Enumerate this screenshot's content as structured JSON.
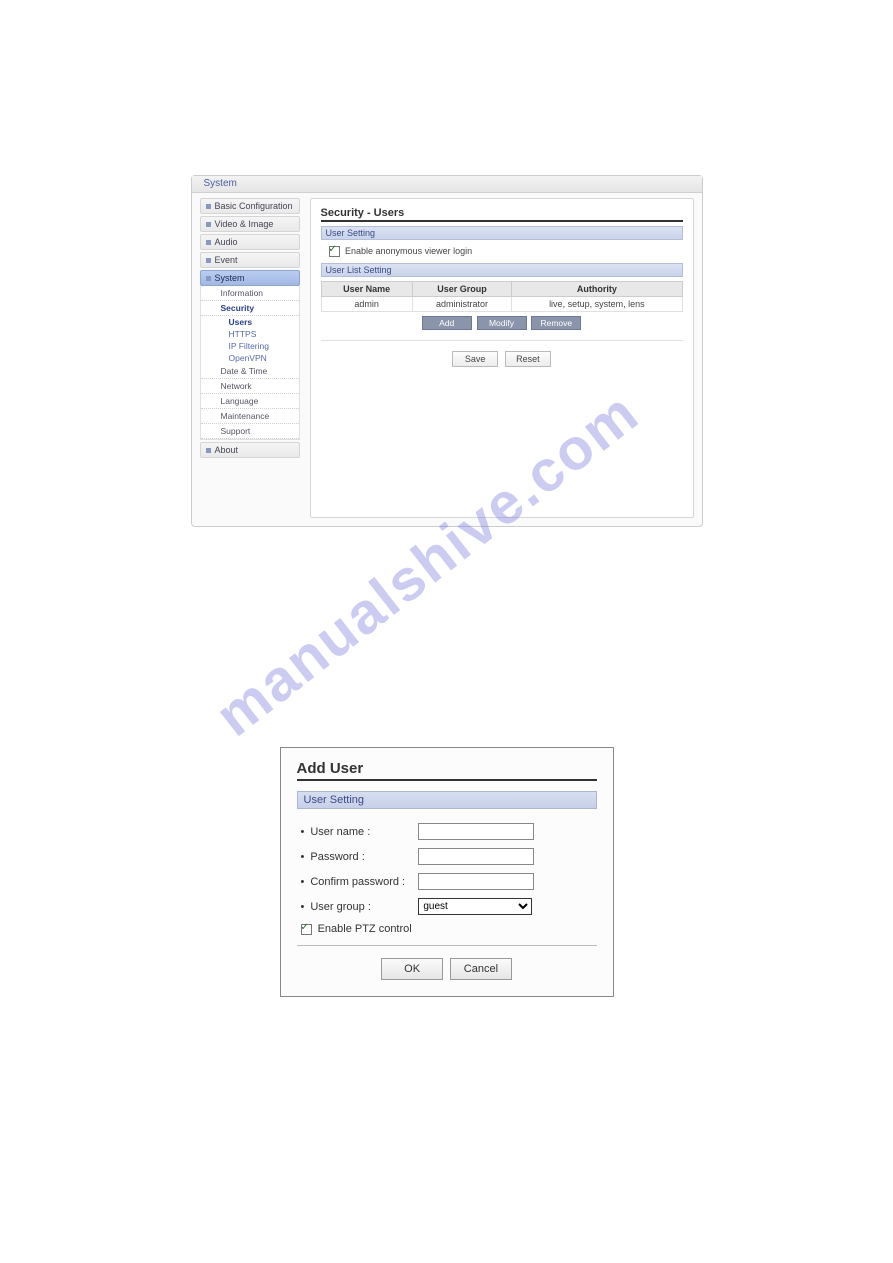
{
  "watermark": "manualshive.com",
  "top_panel": {
    "window_title": "System",
    "sidebar": {
      "items": [
        {
          "label": "Basic Configuration",
          "active": false,
          "subs": []
        },
        {
          "label": "Video & Image",
          "active": false,
          "subs": []
        },
        {
          "label": "Audio",
          "active": false,
          "subs": []
        },
        {
          "label": "Event",
          "active": false,
          "subs": []
        },
        {
          "label": "System",
          "active": true,
          "subs": [
            {
              "label": "Information",
              "level": 1,
              "active": false
            },
            {
              "label": "Security",
              "level": 1,
              "active": true
            },
            {
              "label": "Users",
              "level": 2,
              "active": true
            },
            {
              "label": "HTTPS",
              "level": 2,
              "active": false
            },
            {
              "label": "IP Filtering",
              "level": 2,
              "active": false
            },
            {
              "label": "OpenVPN",
              "level": 2,
              "active": false
            },
            {
              "label": "Date & Time",
              "level": 1,
              "active": false
            },
            {
              "label": "Network",
              "level": 1,
              "active": false
            },
            {
              "label": "Language",
              "level": 1,
              "active": false
            },
            {
              "label": "Maintenance",
              "level": 1,
              "active": false
            },
            {
              "label": "Support",
              "level": 1,
              "active": false
            }
          ]
        },
        {
          "label": "About",
          "active": false,
          "subs": []
        }
      ]
    },
    "content": {
      "heading": "Security - Users",
      "user_setting": {
        "bar_label": "User Setting",
        "anon_check_label": "Enable anonymous viewer login",
        "anon_checked": true
      },
      "user_list": {
        "bar_label": "User List Setting",
        "columns": [
          "User Name",
          "User Group",
          "Authority"
        ],
        "rows": [
          {
            "name": "admin",
            "group": "administrator",
            "authority": "live, setup, system, lens"
          }
        ],
        "buttons": [
          "Add",
          "Modify",
          "Remove"
        ]
      },
      "footer_buttons": [
        "Save",
        "Reset"
      ]
    }
  },
  "dialog": {
    "title": "Add User",
    "section_label": "User Setting",
    "fields": {
      "username": {
        "label": "User name :",
        "value": ""
      },
      "password": {
        "label": "Password :",
        "value": ""
      },
      "confirm": {
        "label": "Confirm password :",
        "value": ""
      },
      "group": {
        "label": "User group :",
        "value": "guest"
      }
    },
    "ptz": {
      "label": "Enable PTZ control",
      "checked": true
    },
    "buttons": [
      "OK",
      "Cancel"
    ]
  }
}
